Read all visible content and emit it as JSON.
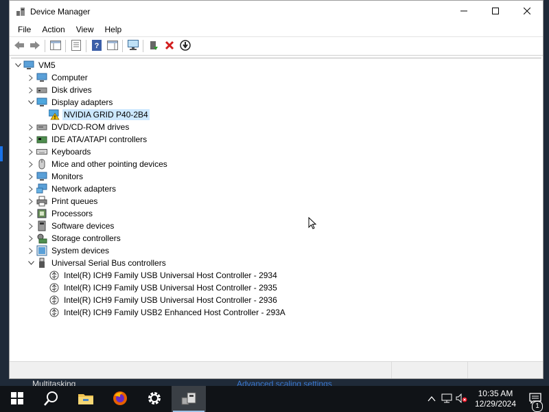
{
  "window": {
    "title": "Device Manager",
    "controls": {
      "minimize": "minimize-icon",
      "maximize": "maximize-icon",
      "close": "close-icon"
    }
  },
  "menu": [
    "File",
    "Action",
    "View",
    "Help"
  ],
  "toolbar": [
    "back-arrow-icon",
    "forward-arrow-icon",
    "show-hide-tree-icon",
    "properties-icon",
    "help-icon",
    "action-pane-icon",
    "scan-hardware-icon",
    "update-driver-icon",
    "uninstall-device-icon",
    "disable-device-icon"
  ],
  "tree": {
    "root": "VM5",
    "items": [
      {
        "label": "Computer",
        "icon": "computer-icon",
        "expanded": false
      },
      {
        "label": "Disk drives",
        "icon": "disk-drive-icon",
        "expanded": false
      },
      {
        "label": "Display adapters",
        "icon": "display-adapter-icon",
        "expanded": true,
        "children": [
          {
            "label": "NVIDIA GRID P40-2B4",
            "icon": "warning-device-icon",
            "selected": true
          }
        ]
      },
      {
        "label": "DVD/CD-ROM drives",
        "icon": "dvd-drive-icon",
        "expanded": false
      },
      {
        "label": "IDE ATA/ATAPI controllers",
        "icon": "ide-controller-icon",
        "expanded": false
      },
      {
        "label": "Keyboards",
        "icon": "keyboard-icon",
        "expanded": false
      },
      {
        "label": "Mice and other pointing devices",
        "icon": "mouse-icon",
        "expanded": false
      },
      {
        "label": "Monitors",
        "icon": "monitor-icon",
        "expanded": false
      },
      {
        "label": "Network adapters",
        "icon": "network-adapter-icon",
        "expanded": false
      },
      {
        "label": "Print queues",
        "icon": "printer-icon",
        "expanded": false
      },
      {
        "label": "Processors",
        "icon": "processor-icon",
        "expanded": false
      },
      {
        "label": "Software devices",
        "icon": "software-device-icon",
        "expanded": false
      },
      {
        "label": "Storage controllers",
        "icon": "storage-controller-icon",
        "expanded": false
      },
      {
        "label": "System devices",
        "icon": "system-device-icon",
        "expanded": false
      },
      {
        "label": "Universal Serial Bus controllers",
        "icon": "usb-icon",
        "expanded": true,
        "children": [
          {
            "label": "Intel(R) ICH9 Family USB Universal Host Controller - 2934",
            "icon": "usb-controller-icon"
          },
          {
            "label": "Intel(R) ICH9 Family USB Universal Host Controller - 2935",
            "icon": "usb-controller-icon"
          },
          {
            "label": "Intel(R) ICH9 Family USB Universal Host Controller - 2936",
            "icon": "usb-controller-icon"
          },
          {
            "label": "Intel(R) ICH9 Family USB2 Enhanced Host Controller - 293A",
            "icon": "usb-controller-icon"
          }
        ]
      }
    ]
  },
  "background_window": {
    "left_text": "Multitasking",
    "right_text": "Advanced scaling settings"
  },
  "taskbar": {
    "items": [
      "start-icon",
      "search-icon",
      "file-explorer-icon",
      "firefox-icon",
      "settings-icon",
      "device-manager-icon"
    ],
    "tray": {
      "time": "10:35 AM",
      "date": "12/29/2024",
      "notification_count": "1"
    }
  },
  "colors": {
    "selection": "#cce8ff",
    "taskbar": "#101317",
    "accent": "#1a73e8"
  }
}
